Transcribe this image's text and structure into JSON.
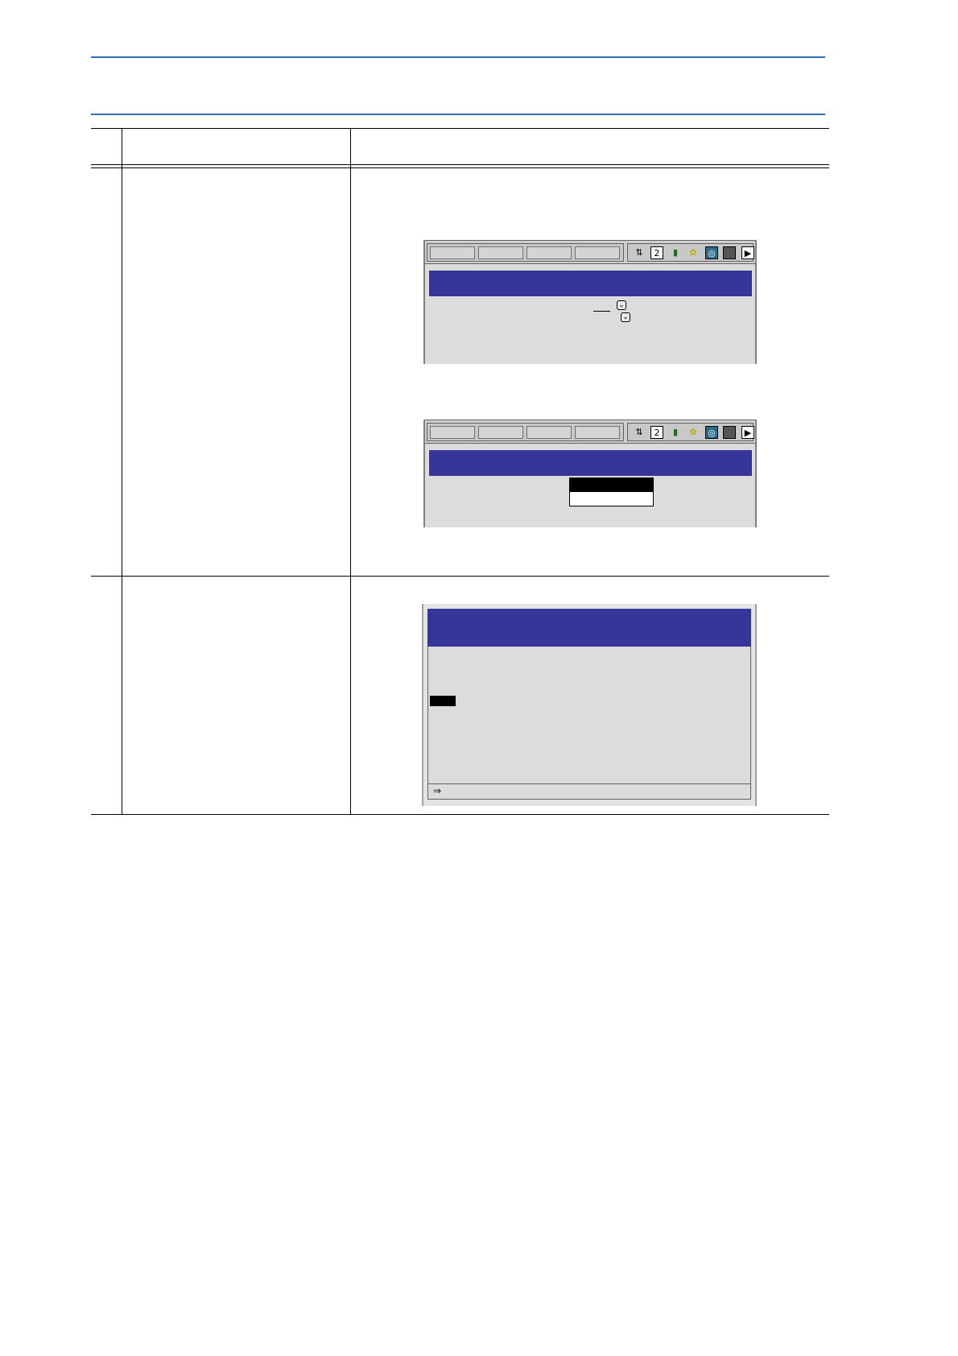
{
  "screens": [
    {
      "toolbar_icons": [
        "teach-mode-icon",
        "page-icon",
        "signal-icon",
        "servo-icon",
        "camera-icon",
        "output-icon",
        "play-icon"
      ]
    },
    {
      "toolbar_icons": [
        "teach-mode-icon",
        "page-icon",
        "signal-icon",
        "servo-icon",
        "camera-icon",
        "output-icon",
        "play-icon"
      ]
    },
    {
      "status_arrow": "⇒"
    }
  ]
}
